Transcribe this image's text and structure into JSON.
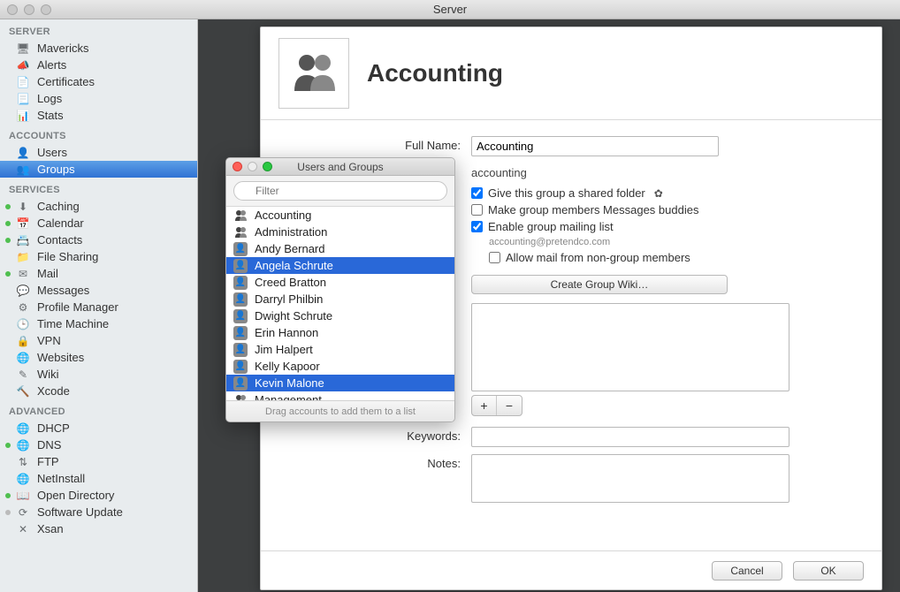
{
  "window": {
    "title": "Server"
  },
  "sidebar": {
    "sections": [
      {
        "label": "SERVER",
        "items": [
          {
            "label": "Mavericks",
            "icon": "monitor-icon"
          },
          {
            "label": "Alerts",
            "icon": "megaphone-icon"
          },
          {
            "label": "Certificates",
            "icon": "certificate-icon"
          },
          {
            "label": "Logs",
            "icon": "log-icon"
          },
          {
            "label": "Stats",
            "icon": "stats-icon"
          }
        ]
      },
      {
        "label": "ACCOUNTS",
        "items": [
          {
            "label": "Users",
            "icon": "user-icon"
          },
          {
            "label": "Groups",
            "icon": "group-icon",
            "selected": true
          }
        ]
      },
      {
        "label": "SERVICES",
        "items": [
          {
            "label": "Caching",
            "icon": "caching-icon",
            "status": "green"
          },
          {
            "label": "Calendar",
            "icon": "calendar-icon",
            "status": "green"
          },
          {
            "label": "Contacts",
            "icon": "contacts-icon",
            "status": "green"
          },
          {
            "label": "File Sharing",
            "icon": "filesharing-icon"
          },
          {
            "label": "Mail",
            "icon": "mail-icon",
            "status": "green"
          },
          {
            "label": "Messages",
            "icon": "messages-icon"
          },
          {
            "label": "Profile Manager",
            "icon": "profile-icon"
          },
          {
            "label": "Time Machine",
            "icon": "timemachine-icon"
          },
          {
            "label": "VPN",
            "icon": "vpn-icon"
          },
          {
            "label": "Websites",
            "icon": "websites-icon"
          },
          {
            "label": "Wiki",
            "icon": "wiki-icon"
          },
          {
            "label": "Xcode",
            "icon": "xcode-icon"
          }
        ]
      },
      {
        "label": "ADVANCED",
        "items": [
          {
            "label": "DHCP",
            "icon": "dhcp-icon"
          },
          {
            "label": "DNS",
            "icon": "dns-icon",
            "status": "green"
          },
          {
            "label": "FTP",
            "icon": "ftp-icon"
          },
          {
            "label": "NetInstall",
            "icon": "netinstall-icon"
          },
          {
            "label": "Open Directory",
            "icon": "od-icon",
            "status": "green"
          },
          {
            "label": "Software Update",
            "icon": "swupdate-icon",
            "status": "gray"
          },
          {
            "label": "Xsan",
            "icon": "xsan-icon"
          }
        ]
      }
    ]
  },
  "panel": {
    "title": "Accounting",
    "full_name_label": "Full Name:",
    "full_name_value": "Accounting",
    "short_name_value": "accounting",
    "shared_folder_label": "Give this group a shared folder",
    "shared_folder_checked": true,
    "messages_buddies_label": "Make group members Messages buddies",
    "messages_buddies_checked": false,
    "mailing_list_label": "Enable group mailing list",
    "mailing_list_checked": true,
    "mailing_address": "accounting@pretendco.com",
    "allow_nonmembers_label": "Allow mail from non-group members",
    "allow_nonmembers_checked": false,
    "create_wiki_label": "Create Group Wiki…",
    "keywords_label": "Keywords:",
    "notes_label": "Notes:",
    "cancel_label": "Cancel",
    "ok_label": "OK",
    "add_label": "+",
    "remove_label": "−"
  },
  "popover": {
    "title": "Users and Groups",
    "filter_placeholder": "Filter",
    "footer": "Drag accounts to add them to a list",
    "items": [
      {
        "label": "Accounting",
        "type": "group"
      },
      {
        "label": "Administration",
        "type": "group"
      },
      {
        "label": "Andy Bernard",
        "type": "user"
      },
      {
        "label": "Angela Schrute",
        "type": "user",
        "selected": true
      },
      {
        "label": "Creed Bratton",
        "type": "user"
      },
      {
        "label": "Darryl Philbin",
        "type": "user"
      },
      {
        "label": "Dwight Schrute",
        "type": "user"
      },
      {
        "label": "Erin Hannon",
        "type": "user"
      },
      {
        "label": "Jim Halpert",
        "type": "user"
      },
      {
        "label": "Kelly Kapoor",
        "type": "user"
      },
      {
        "label": "Kevin Malone",
        "type": "user",
        "selected": true
      },
      {
        "label": "Management",
        "type": "group"
      }
    ]
  }
}
